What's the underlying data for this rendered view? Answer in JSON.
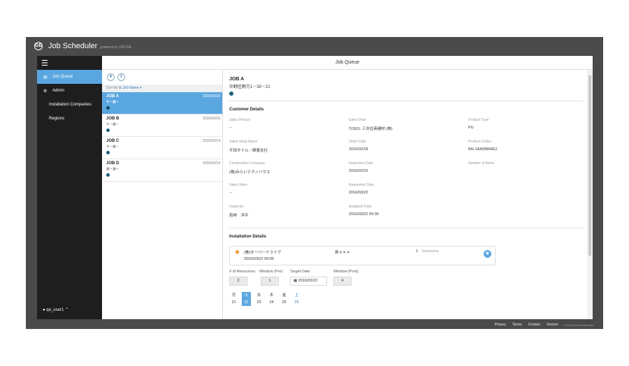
{
  "app": {
    "title": "Job Scheduler",
    "powered_by": "powered by FRCDA",
    "logo_text": "GE"
  },
  "sidebar": {
    "menu_icon": "hamburger-icon",
    "items": [
      {
        "label": "Job Queue",
        "icon": "list-icon",
        "active": true
      },
      {
        "label": "Admin",
        "icon": "gear-icon"
      },
      {
        "label": "Installation Companies"
      },
      {
        "label": "Regions"
      }
    ],
    "user": "qa_user1"
  },
  "header": {
    "title": "Job Queue"
  },
  "list": {
    "sort_label": "Sort By",
    "sort_value": "Job Name",
    "jobs": [
      {
        "name": "JOB A",
        "date": "2016/02/18",
        "icons": "⚙ ▪   ▦ ▪",
        "active": true
      },
      {
        "name": "JOB B",
        "date": "2016/02/18",
        "icons": "⚙ ▪   ▦ ▪"
      },
      {
        "name": "JOB C",
        "date": "2016/02/14",
        "icons": "⚙ ▪   ▦ ▪"
      },
      {
        "name": "JOB D",
        "date": "2016/02/14",
        "icons": "▦ ▪   ▦ ▪"
      }
    ]
  },
  "detail": {
    "title": "JOB A",
    "address": "中野区野方1－30－21",
    "customer_title": "Customer Details",
    "fields": {
      "sales_person": {
        "label": "Sales Person",
        "value": "--"
      },
      "sales_dept": {
        "label": "Sales Dept",
        "value": "TODO: 三井住商建材 (株)"
      },
      "product_type": {
        "label": "Product Type",
        "value": "PU"
      },
      "sales_shop_name": {
        "label": "Sales Shop Name",
        "value": "平田タイル／関東支社"
      },
      "order_date": {
        "label": "Order Date",
        "value": "2016/02/18"
      },
      "product_codes": {
        "label": "Product Codes",
        "value": "BH-1AA05BWE2"
      },
      "construction_company": {
        "label": "Construction Company",
        "value": "(株)みらいテクノハウス"
      },
      "inspection_date": {
        "label": "Inspection Date",
        "value": "2016/02/23"
      },
      "number_of_items": {
        "label": "Number of Items",
        "value": ""
      },
      "sales_store": {
        "label": "Sales Store",
        "value": "--"
      },
      "requested_date": {
        "label": "Requested Date",
        "value": "2016/03/22"
      },
      "inspector": {
        "label": "Inspector",
        "value": "若林　洋平"
      },
      "assigned_date": {
        "label": "Assigned Date",
        "value": "2016/03/22 09:00"
      }
    },
    "installation_title": "Installation Details",
    "installation": {
      "company": "(株)オーバードライブ",
      "datetime": "2016/03/22 09:00",
      "person": "鳥＊＊＊",
      "resource_count": "1",
      "resource_label": "Resource"
    },
    "inputs": {
      "resources_label": "# of Resources",
      "resources_value": "2",
      "window_pre_label": "Window (Pre)",
      "window_pre_value": "1",
      "target_date_label": "Target Date",
      "target_date_value": "2016/03/22",
      "window_post_label": "Window (Post)",
      "window_post_value": "4"
    },
    "calendar": {
      "weekdays": [
        "月",
        "火",
        "水",
        "木",
        "金",
        "土"
      ],
      "days": [
        "21",
        "22",
        "23",
        "24",
        "25",
        "26"
      ],
      "selected_index": 1
    }
  },
  "footer": {
    "links": [
      "Privacy",
      "Terms",
      "Contact",
      "Version"
    ],
    "copyright": "©2016 General Electric"
  },
  "colors": {
    "accent": "#5aa7e0",
    "sidebar_bg": "#1e1e1e",
    "frame_bg": "#4a4a4a",
    "star": "#e88a1a"
  }
}
